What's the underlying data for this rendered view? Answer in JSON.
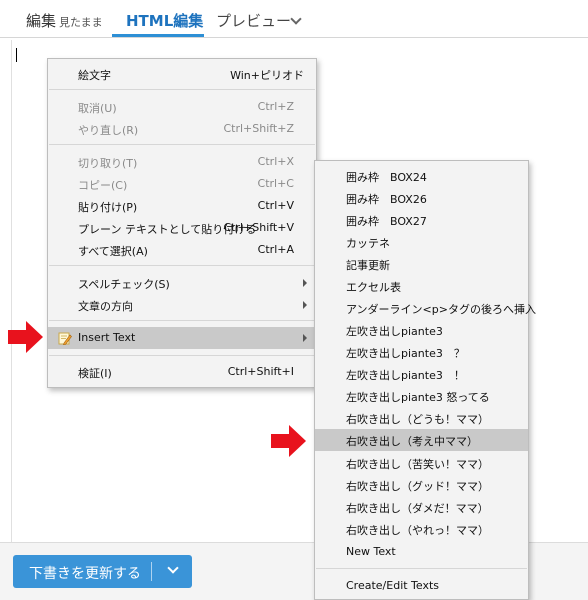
{
  "tabs": {
    "edit_label": "編集",
    "edit_sub": "見たまま",
    "html_label": "HTML編集",
    "preview_label": "プレビュー"
  },
  "bottom": {
    "update_label": "下書きを更新する"
  },
  "context_menu": {
    "emoji": {
      "label": "絵文字",
      "shortcut": "Win+ピリオド"
    },
    "undo": {
      "label": "取消(U)",
      "shortcut": "Ctrl+Z"
    },
    "redo": {
      "label": "やり直し(R)",
      "shortcut": "Ctrl+Shift+Z"
    },
    "cut": {
      "label": "切り取り(T)",
      "shortcut": "Ctrl+X"
    },
    "copy": {
      "label": "コピー(C)",
      "shortcut": "Ctrl+C"
    },
    "paste": {
      "label": "貼り付け(P)",
      "shortcut": "Ctrl+V"
    },
    "paste_plain": {
      "label": "プレーン テキストとして貼り付ける",
      "shortcut": "Ctrl+Shift+V"
    },
    "select_all": {
      "label": "すべて選択(A)",
      "shortcut": "Ctrl+A"
    },
    "spellcheck": {
      "label": "スペルチェック(S)"
    },
    "direction": {
      "label": "文章の方向"
    },
    "insert_text": {
      "label": "Insert Text"
    },
    "inspect": {
      "label": "検証(I)",
      "shortcut": "Ctrl+Shift+I"
    }
  },
  "submenu": {
    "items": [
      "囲み枠　BOX24",
      "囲み枠　BOX26",
      "囲み枠　BOX27",
      "カッテネ",
      "記事更新",
      "エクセル表",
      "アンダーライン<p>タグの後ろへ挿入",
      "左吹き出しpiante3",
      "左吹き出しpiante3　？",
      "左吹き出しpiante3　！",
      "左吹き出しpiante3 怒ってる",
      " 右吹き出し（どうも！ママ）",
      "右吹き出し（考え中ママ）",
      "右吹き出し（苦笑い！ママ）",
      "右吹き出し（グッド！ママ）",
      "右吹き出し（ダメだ！ママ）",
      "右吹き出し（やれっ！ママ）",
      "New Text"
    ],
    "create_edit": "Create/Edit Texts"
  },
  "colors": {
    "accent": "#1e73be",
    "button": "#3a94d8",
    "highlight": "#c9c9c9",
    "arrow": "#e8121d"
  },
  "icons": {
    "insert_text_icon": "pencil-note-icon",
    "pointer_arrows": "red-arrow-icon"
  }
}
